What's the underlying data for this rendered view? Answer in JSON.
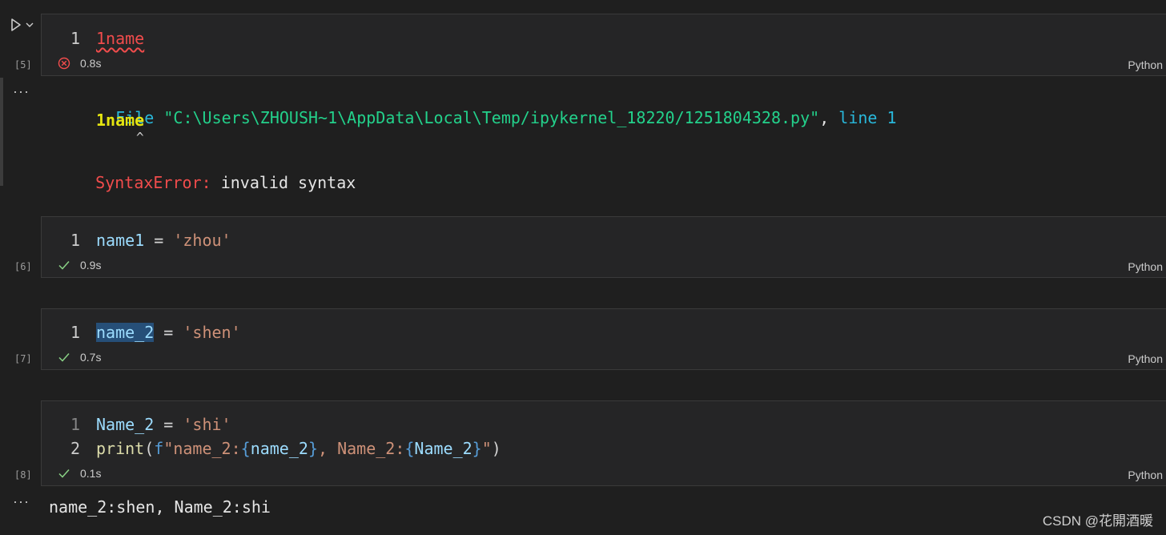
{
  "cells": [
    {
      "exec_count": "[5]",
      "status": "error",
      "time": "0.8s",
      "lang": "Python",
      "lines": [
        {
          "num": "1",
          "code": "1name"
        }
      ]
    },
    {
      "exec_count": "[6]",
      "status": "success",
      "time": "0.9s",
      "lang": "Python",
      "lines": [
        {
          "num": "1",
          "var": "name1",
          "op": " = ",
          "str": "'zhou'"
        }
      ]
    },
    {
      "exec_count": "[7]",
      "status": "success",
      "time": "0.7s",
      "lang": "Python",
      "lines": [
        {
          "num": "1",
          "var": "name_2",
          "op": " = ",
          "str": "'shen'"
        }
      ]
    },
    {
      "exec_count": "[8]",
      "status": "success",
      "time": "0.1s",
      "lang": "Python",
      "lines": [
        {
          "num": "1",
          "var": "Name_2",
          "op": " = ",
          "str": "'shi'"
        },
        {
          "num": "2",
          "fn": "print",
          "p_open": "(",
          "fkw": "f",
          "s1": "\"name_2:",
          "b1": "{",
          "v1": "name_2",
          "b2": "}",
          "s2": ", Name_2:",
          "b3": "{",
          "v2": "Name_2",
          "b4": "}",
          "s3": "\"",
          "p_close": ")"
        }
      ]
    }
  ],
  "error_output": {
    "ellipsis": "···",
    "file_kw": "File",
    "file_path": "\"C:\\Users\\ZHOUSH~1\\AppData\\Local\\Temp/ipykernel_18220/1251804328.py\"",
    "comma": ",",
    "line_kw": "line 1",
    "code": "1name",
    "caret": "^",
    "err_type": "SyntaxError:",
    "err_msg": "invalid syntax"
  },
  "stdout_output": {
    "ellipsis": "···",
    "text": "name_2:shen, Name_2:shi"
  },
  "watermark": "CSDN @花開酒暖",
  "colors": {
    "error": "#f14c4c",
    "success": "#89d185",
    "background": "#1f1f1f",
    "cell_bg": "#252526"
  }
}
